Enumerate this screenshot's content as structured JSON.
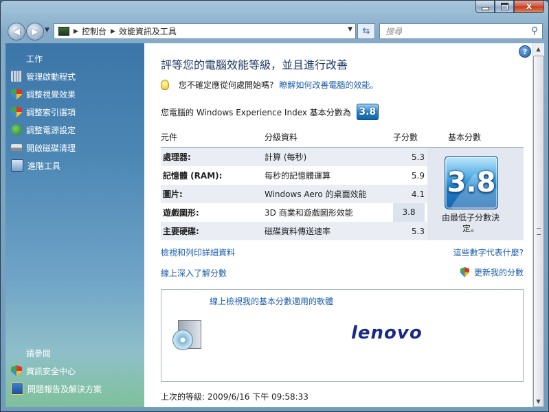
{
  "window": {
    "close_glyph": "x"
  },
  "nav": {
    "back_glyph": "◀",
    "forward_glyph": "▶",
    "breadcrumb": [
      "控制台",
      "效能資訊及工具"
    ],
    "search_placeholder": "搜尋"
  },
  "sidebar": {
    "tasks_heading": "工作",
    "tasks": [
      {
        "label": "管理啟動程式",
        "icon": "startup-programs-icon"
      },
      {
        "label": "調整視覺效果",
        "icon": "shield-icon"
      },
      {
        "label": "調整索引選項",
        "icon": "shield-icon"
      },
      {
        "label": "調整電源設定",
        "icon": "power-icon"
      },
      {
        "label": "開啟磁碟清理",
        "icon": "disk-cleanup-icon"
      },
      {
        "label": "進階工具",
        "icon": "advanced-tools-icon"
      }
    ],
    "see_also_heading": "請參閱",
    "see_also": [
      {
        "label": "資訊安全中心",
        "icon": "shield-icon"
      },
      {
        "label": "問題報告及解決方案",
        "icon": "problem-reports-icon"
      }
    ]
  },
  "main": {
    "title": "評等您的電腦效能等級，並且進行改善",
    "tip_text": "您不確定應從何處開始嗎?",
    "tip_link": "瞭解如何改善電腦的效能。",
    "score_text": "您電腦的 Windows Experience Index 基本分數為",
    "base_score": "3.8",
    "table": {
      "headers": [
        "元件",
        "分級資料",
        "子分數",
        "基本分數"
      ],
      "rows": [
        {
          "component": "處理器:",
          "rating": "計算 (每秒)",
          "subscore": "5.3"
        },
        {
          "component": "記憶體 (RAM):",
          "rating": "每秒的記憶體運算",
          "subscore": "5.9"
        },
        {
          "component": "圖片:",
          "rating": "Windows Aero 的桌面效能",
          "subscore": "4.1"
        },
        {
          "component": "遊戲圖形:",
          "rating": "3D 商業和遊戲圖形效能",
          "subscore": "3.8"
        },
        {
          "component": "主要硬碟:",
          "rating": "磁碟資料傳送速率",
          "subscore": "5.3"
        }
      ],
      "base_caption": "由最低子分數決定。"
    },
    "links": {
      "view_print": "檢視和列印詳細資料",
      "what_numbers": "這些數字代表什麼?",
      "learn_online": "線上深入了解分數",
      "update": "更新我的分數"
    },
    "software": {
      "title": "線上檢視我的基本分數適用的軟體",
      "brand": "lenovo"
    },
    "last_rated": "上次的等級: 2009/6/16 下午 09:58:33"
  }
}
